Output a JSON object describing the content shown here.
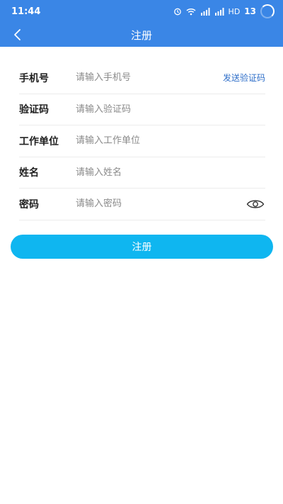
{
  "status_bar": {
    "time": "11:44",
    "network_label": "HD",
    "battery": "13"
  },
  "header": {
    "title": "注册",
    "background_color": "#3a86e6"
  },
  "form": {
    "phone": {
      "label": "手机号",
      "placeholder": "请输入手机号",
      "value": "",
      "action": "发送验证码"
    },
    "code": {
      "label": "验证码",
      "placeholder": "请输入验证码",
      "value": ""
    },
    "company": {
      "label": "工作单位",
      "placeholder": "请输入工作单位",
      "value": ""
    },
    "name": {
      "label": "姓名",
      "placeholder": "请输入姓名",
      "value": ""
    },
    "password": {
      "label": "密码",
      "placeholder": "请输入密码",
      "value": "",
      "icon": "eye-icon"
    }
  },
  "submit": {
    "label": "注册",
    "color": "#0fb6f0"
  }
}
